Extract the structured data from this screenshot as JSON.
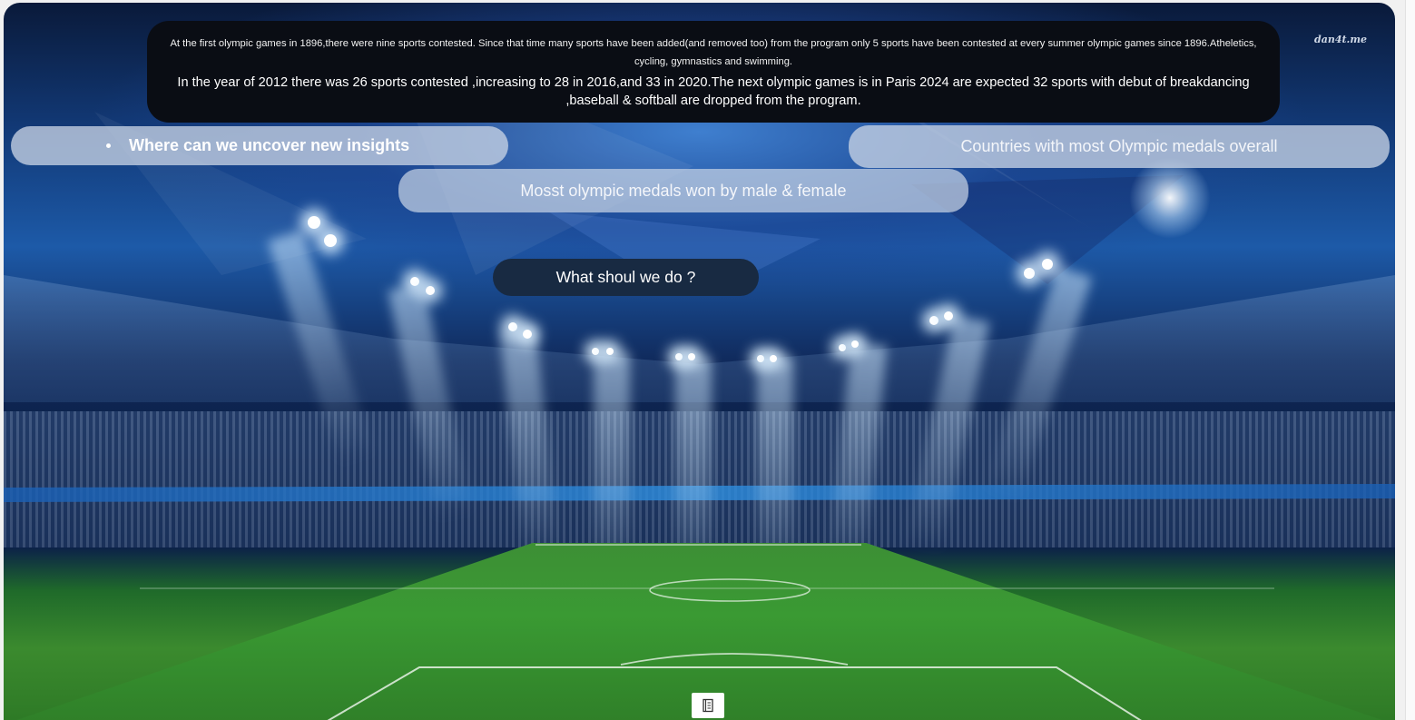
{
  "info_panel": {
    "line1": "At the first olympic games in 1896,there were nine sports contested. Since that time many sports have been added(and removed too) from the program only 5 sports have been contested at every summer olympic games since 1896.Atheletics, cycling, gymnastics and swimming.",
    "line2": "In the year of 2012 there was 26 sports contested ,increasing to 28 in 2016,and 33 in 2020.The next olympic games is in Paris 2024 are expected 32 sports with debut of breakdancing ,baseball & softball are dropped from the program."
  },
  "buttons": {
    "insights": "Where can we uncover new insights",
    "countries": "Countries with most Olympic medals overall",
    "medals_gender": "Mosst olympic medals won by male & female",
    "what_should": "What shoul we do ?"
  },
  "watermark": "dan4t.me",
  "icons": {
    "bottom_button": "book-icon"
  }
}
